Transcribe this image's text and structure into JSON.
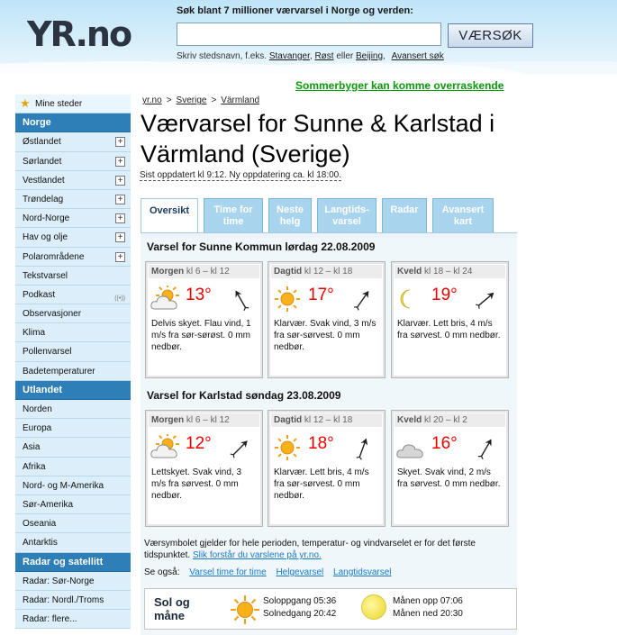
{
  "header": {
    "logo": "YR.no",
    "search_heading": "Søk blant 7 millioner værvarsel i Norge og verden:",
    "search_value": "",
    "search_placeholder": "",
    "search_button": "VÆRSØK",
    "hint_prefix": "Skriv stedsnavn, f.eks.",
    "hint_links": [
      "Stavanger",
      "Røst",
      "Beijing"
    ],
    "hint_sep": ",",
    "hint_or": "eller",
    "hint_advanced": "Avansert søk"
  },
  "banner": "Sommerbyger kan komme overraskende",
  "breadcrumb": [
    "yr.no",
    "Sverige",
    "Värmland"
  ],
  "title": "Værvarsel for Sunne & Karlstad i Värmland (Sverige)",
  "updated": "Sist oppdatert kl 9:12. Ny oppdatering ca. kl 18:00.",
  "sidebar": {
    "items": [
      {
        "label": "Mine steder",
        "type": "top"
      },
      {
        "label": "Norge",
        "type": "section"
      },
      {
        "label": "Østlandet",
        "type": "item",
        "expand": true
      },
      {
        "label": "Sørlandet",
        "type": "item",
        "expand": true
      },
      {
        "label": "Vestlandet",
        "type": "item",
        "expand": true
      },
      {
        "label": "Trøndelag",
        "type": "item",
        "expand": true
      },
      {
        "label": "Nord-Norge",
        "type": "item",
        "expand": true
      },
      {
        "label": "Hav og olje",
        "type": "item",
        "expand": true
      },
      {
        "label": "Polarområdene",
        "type": "item",
        "expand": true
      },
      {
        "label": "Tekstvarsel",
        "type": "item"
      },
      {
        "label": "Podkast",
        "type": "item",
        "rss": true
      },
      {
        "label": "Observasjoner",
        "type": "item"
      },
      {
        "label": "Klima",
        "type": "item"
      },
      {
        "label": "Pollenvarsel",
        "type": "item"
      },
      {
        "label": "Badetemperaturer",
        "type": "item"
      },
      {
        "label": "Utlandet",
        "type": "section"
      },
      {
        "label": "Norden",
        "type": "item"
      },
      {
        "label": "Europa",
        "type": "item"
      },
      {
        "label": "Asia",
        "type": "item"
      },
      {
        "label": "Afrika",
        "type": "item"
      },
      {
        "label": "Nord- og M-Amerika",
        "type": "item"
      },
      {
        "label": "Sør-Amerika",
        "type": "item"
      },
      {
        "label": "Oseania",
        "type": "item"
      },
      {
        "label": "Antarktis",
        "type": "item"
      },
      {
        "label": "Radar og satellitt",
        "type": "section"
      },
      {
        "label": "Radar: Sør-Norge",
        "type": "item"
      },
      {
        "label": "Radar: Nordl./Troms",
        "type": "item"
      },
      {
        "label": "Radar: flere...",
        "type": "item"
      }
    ]
  },
  "tabs": [
    {
      "label": "Oversikt",
      "active": true
    },
    {
      "label": "Time for\ntime",
      "active": false
    },
    {
      "label": "Neste\nhelg",
      "active": false
    },
    {
      "label": "Langtids-\nvarsel",
      "active": false
    },
    {
      "label": "Radar",
      "active": false
    },
    {
      "label": "Avansert\nkart",
      "active": false
    }
  ],
  "forecasts": [
    {
      "title": "Varsel for Sunne Kommun lørdag 22.08.2009",
      "periods": [
        {
          "name": "Morgen",
          "range": "kl 6 – kl 12",
          "icon": "partly-cloudy-icon",
          "temp": "13°",
          "wind_deg": 330,
          "text": "Delvis skyet. Flau vind, 1 m/s fra sør-sørøst. 0 mm nedbør."
        },
        {
          "name": "Dagtid",
          "range": "kl 12 – kl 18",
          "icon": "sun-icon",
          "temp": "17°",
          "wind_deg": 35,
          "text": "Klarvær. Svak vind, 3 m/s fra sør-sørvest. 0 mm nedbør."
        },
        {
          "name": "Kveld",
          "range": "kl 18 – kl 24",
          "icon": "moon-icon",
          "temp": "19°",
          "wind_deg": 50,
          "text": "Klarvær. Lett bris, 4 m/s fra sørvest. 0 mm nedbør."
        }
      ]
    },
    {
      "title": "Varsel for Karlstad søndag 23.08.2009",
      "periods": [
        {
          "name": "Morgen",
          "range": "kl 6 – kl 12",
          "icon": "partly-cloudy-icon",
          "temp": "12°",
          "wind_deg": 45,
          "text": "Lettskyet. Svak vind, 3 m/s fra sørvest. 0 mm nedbør."
        },
        {
          "name": "Dagtid",
          "range": "kl 12 – kl 18",
          "icon": "sun-icon",
          "temp": "18°",
          "wind_deg": 20,
          "text": "Klarvær. Lett bris, 4 m/s fra sør-sørvest. 0 mm nedbør."
        },
        {
          "name": "Kveld",
          "range": "kl 20 – kl 2",
          "icon": "cloud-icon",
          "temp": "16°",
          "wind_deg": 30,
          "text": "Skyet. Svak vind, 2 m/s fra sørvest. 0 mm nedbør."
        }
      ]
    }
  ],
  "note": {
    "text": "Værsymbolet gjelder for hele perioden, temperatur- og vindvarselet er for det første tidspunktet.",
    "link": "Slik forstår du varslene på yr.no."
  },
  "see_also": {
    "label": "Se også:",
    "links": [
      "Varsel time for time",
      "Helgevarsel",
      "Langtidsvarsel"
    ]
  },
  "sun_moon": {
    "title": "Sol og\nmåne",
    "sunrise": "Soloppgang 05:36",
    "sunset": "Solnedgang 20:42",
    "moonrise": "Månen opp 07:06",
    "moonset": "Månen ned 20:30"
  },
  "colors": {
    "accent": "#2e7eb8",
    "temp": "#e00000",
    "banner": "#0a9a0a"
  }
}
